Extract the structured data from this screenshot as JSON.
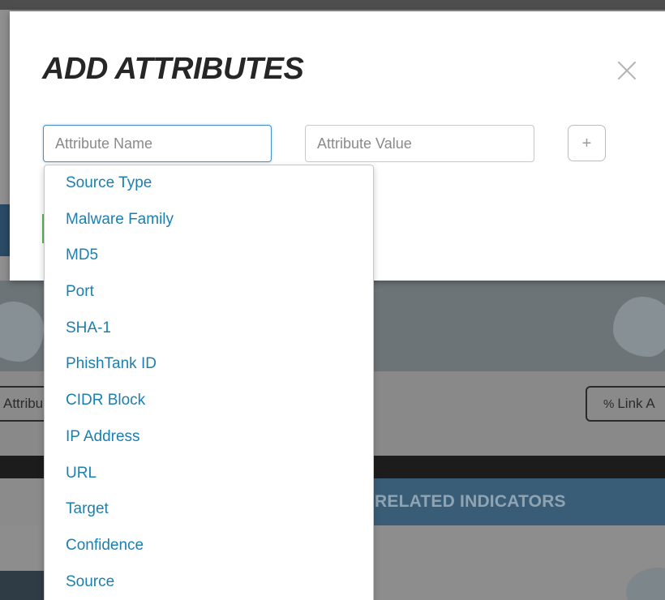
{
  "background": {
    "attributes_button_label": "Attribu",
    "link_button_label": "Link A",
    "related_indicators_label": "RELATED INDICATORS"
  },
  "modal": {
    "title": "ADD ATTRIBUTES",
    "close_icon": "close-icon",
    "attribute_name_placeholder": "Attribute Name",
    "attribute_value_placeholder": "Attribute Value",
    "add_button_label": "+"
  },
  "dropdown": {
    "items": [
      "Source Type",
      "Malware Family",
      "MD5",
      "Port",
      "SHA-1",
      "PhishTank ID",
      "CIDR Block",
      "IP Address",
      "URL",
      "Target",
      "Confidence",
      "Source"
    ]
  },
  "colors": {
    "link_blue": "#1b7fb0",
    "focus_border": "#4a90c8",
    "header_blue": "#3a5d77"
  }
}
